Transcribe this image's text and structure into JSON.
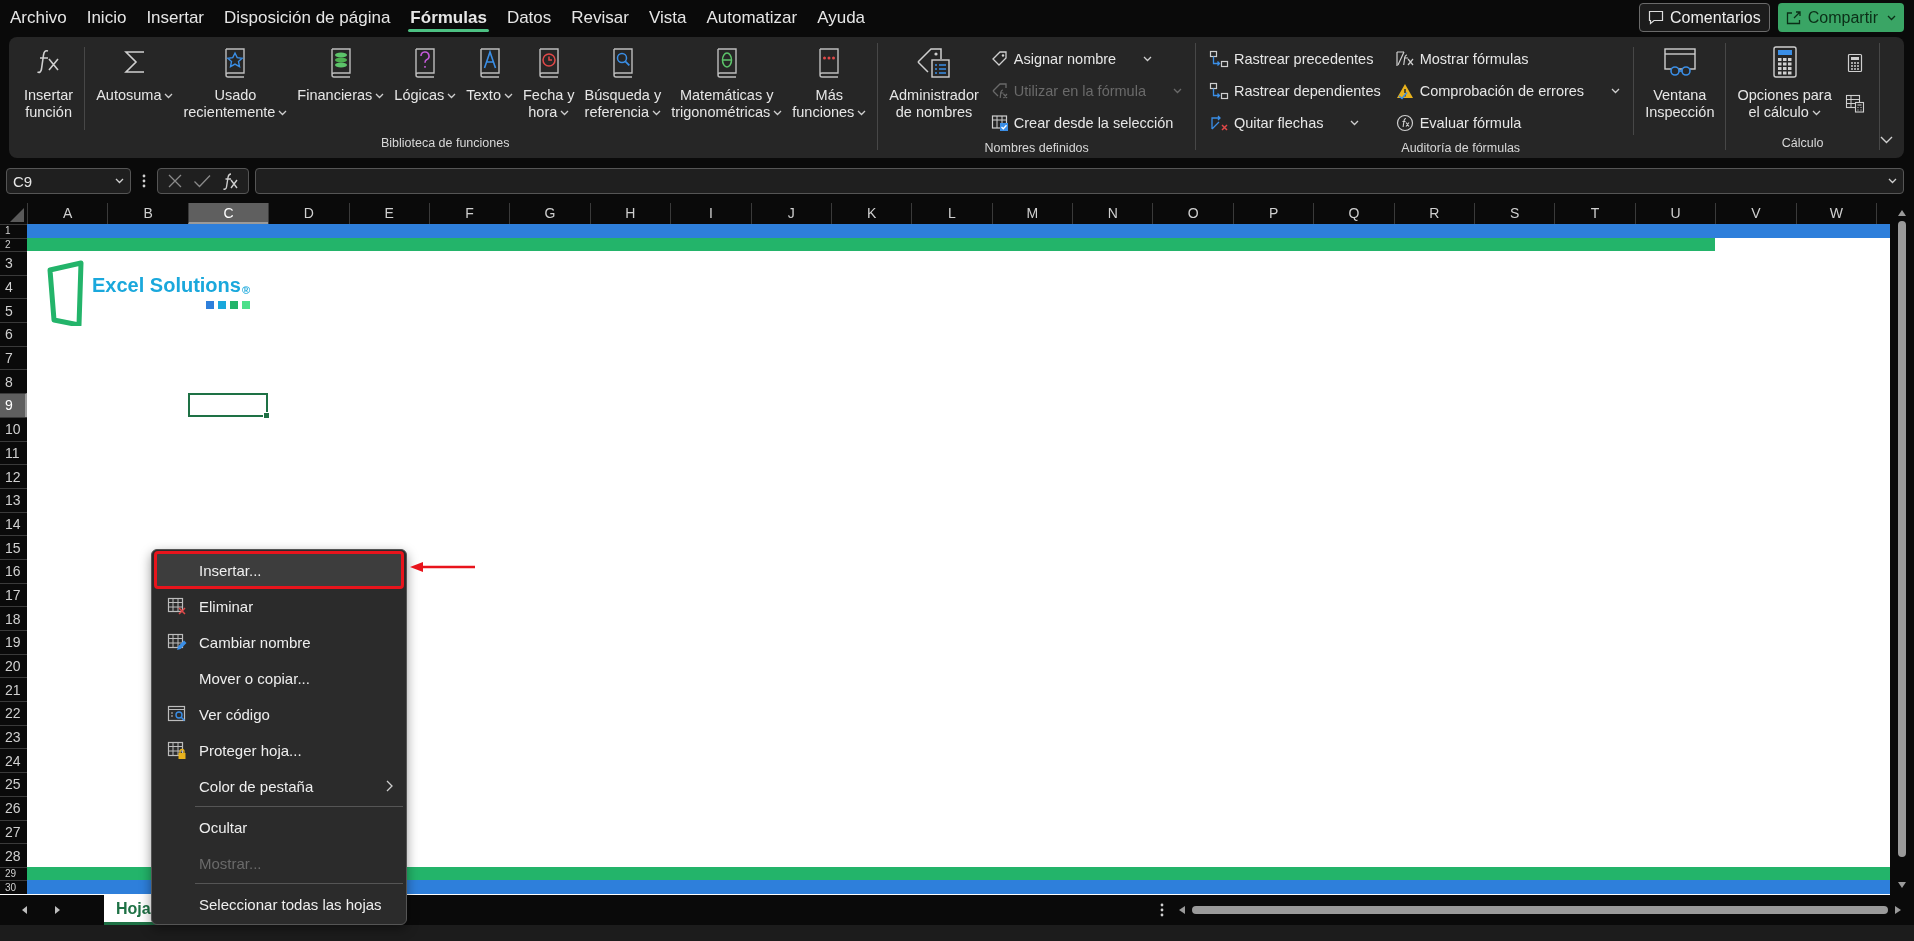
{
  "menu_tabs": [
    {
      "label": "Archivo",
      "selected": false
    },
    {
      "label": "Inicio",
      "selected": false
    },
    {
      "label": "Insertar",
      "selected": false
    },
    {
      "label": "Disposición de página",
      "selected": false
    },
    {
      "label": "Fórmulas",
      "selected": true
    },
    {
      "label": "Datos",
      "selected": false
    },
    {
      "label": "Revisar",
      "selected": false
    },
    {
      "label": "Vista",
      "selected": false
    },
    {
      "label": "Automatizar",
      "selected": false
    },
    {
      "label": "Ayuda",
      "selected": false
    }
  ],
  "header_buttons": [
    {
      "label": "Comentarios",
      "kind": "outline",
      "dropdown": false
    },
    {
      "label": "Compartir",
      "kind": "primary",
      "dropdown": true
    }
  ],
  "ribbon": {
    "groups": [
      {
        "label": "Biblioteca de funciones",
        "items": [
          {
            "kind": "large",
            "label": "Insertar\nfunción",
            "dropdown": false,
            "divider_after": true
          },
          {
            "kind": "large",
            "label": "Autosuma",
            "dropdown": true
          },
          {
            "kind": "large",
            "label": "Usado\nrecientemente",
            "dropdown": true
          },
          {
            "kind": "large",
            "label": "Financieras",
            "dropdown": true
          },
          {
            "kind": "large",
            "label": "Lógicas",
            "dropdown": true
          },
          {
            "kind": "large",
            "label": "Texto",
            "dropdown": true
          },
          {
            "kind": "large",
            "label": "Fecha y\nhora",
            "dropdown": true
          },
          {
            "kind": "large",
            "label": "Búsqueda y\nreferencia",
            "dropdown": true
          },
          {
            "kind": "large",
            "label": "Matemáticas y\ntrigonométricas",
            "dropdown": true
          },
          {
            "kind": "large",
            "label": "Más\nfunciones",
            "dropdown": true
          }
        ]
      },
      {
        "label": "Nombres definidos",
        "items": [
          {
            "kind": "large",
            "label": "Administrador\nde nombres",
            "dropdown": false
          },
          {
            "kind": "stack",
            "buttons": [
              {
                "label": "Asignar nombre",
                "dropdown": true,
                "disabled": false
              },
              {
                "label": "Utilizar en la fórmula",
                "dropdown": true,
                "disabled": true
              },
              {
                "label": "Crear desde la selección",
                "dropdown": false,
                "disabled": false
              }
            ]
          }
        ]
      },
      {
        "label": "Auditoría de fórmulas",
        "items": [
          {
            "kind": "stack",
            "buttons": [
              {
                "label": "Rastrear precedentes",
                "dropdown": false,
                "disabled": false
              },
              {
                "label": "Rastrear dependientes",
                "dropdown": false,
                "disabled": false
              },
              {
                "label": "Quitar flechas",
                "dropdown": true,
                "disabled": false
              }
            ]
          },
          {
            "kind": "stack",
            "buttons": [
              {
                "label": "Mostrar fórmulas",
                "dropdown": false,
                "disabled": false
              },
              {
                "label": "Comprobación de errores",
                "dropdown": true,
                "disabled": false
              },
              {
                "label": "Evaluar fórmula",
                "dropdown": false,
                "disabled": false
              }
            ]
          },
          {
            "kind": "large",
            "label": "Ventana\nInspección",
            "dropdown": false,
            "divider_before": true
          }
        ]
      },
      {
        "label": "Cálculo",
        "items": [
          {
            "kind": "large",
            "label": "Opciones para\nel cálculo",
            "dropdown": true
          },
          {
            "kind": "icon_stack"
          }
        ]
      }
    ]
  },
  "formula_bar": {
    "name_box": "C9"
  },
  "columns": [
    {
      "label": "A",
      "selected": false
    },
    {
      "label": "B",
      "selected": false
    },
    {
      "label": "C",
      "selected": true
    },
    {
      "label": "D",
      "selected": false
    },
    {
      "label": "E",
      "selected": false
    },
    {
      "label": "F",
      "selected": false
    },
    {
      "label": "G",
      "selected": false
    },
    {
      "label": "H",
      "selected": false
    },
    {
      "label": "I",
      "selected": false
    },
    {
      "label": "J",
      "selected": false
    },
    {
      "label": "K",
      "selected": false
    },
    {
      "label": "L",
      "selected": false
    },
    {
      "label": "M",
      "selected": false
    },
    {
      "label": "N",
      "selected": false
    },
    {
      "label": "O",
      "selected": false
    },
    {
      "label": "P",
      "selected": false
    },
    {
      "label": "Q",
      "selected": false
    },
    {
      "label": "R",
      "selected": false
    },
    {
      "label": "S",
      "selected": false
    },
    {
      "label": "T",
      "selected": false
    },
    {
      "label": "U",
      "selected": false
    },
    {
      "label": "V",
      "selected": false
    },
    {
      "label": "W",
      "selected": false
    }
  ],
  "rows": [
    {
      "label": "1",
      "selected": false,
      "color": "#2e7fdb",
      "band_partial": false
    },
    {
      "label": "2",
      "selected": false,
      "color": "#23b46a",
      "band_partial": true
    },
    {
      "label": "3",
      "selected": false
    },
    {
      "label": "4",
      "selected": false
    },
    {
      "label": "5",
      "selected": false
    },
    {
      "label": "6",
      "selected": false
    },
    {
      "label": "7",
      "selected": false
    },
    {
      "label": "8",
      "selected": false
    },
    {
      "label": "9",
      "selected": true
    },
    {
      "label": "10",
      "selected": false
    },
    {
      "label": "11",
      "selected": false
    },
    {
      "label": "12",
      "selected": false
    },
    {
      "label": "13",
      "selected": false
    },
    {
      "label": "14",
      "selected": false
    },
    {
      "label": "15",
      "selected": false
    },
    {
      "label": "16",
      "selected": false
    },
    {
      "label": "17",
      "selected": false
    },
    {
      "label": "18",
      "selected": false
    },
    {
      "label": "19",
      "selected": false
    },
    {
      "label": "20",
      "selected": false
    },
    {
      "label": "21",
      "selected": false
    },
    {
      "label": "22",
      "selected": false
    },
    {
      "label": "23",
      "selected": false
    },
    {
      "label": "24",
      "selected": false
    },
    {
      "label": "25",
      "selected": false
    },
    {
      "label": "26",
      "selected": false
    },
    {
      "label": "27",
      "selected": false
    },
    {
      "label": "28",
      "selected": false
    },
    {
      "label": "29",
      "selected": false,
      "color": "#23b46a",
      "band_partial": false
    },
    {
      "label": "30",
      "selected": false,
      "color": "#2e7fdb",
      "band_partial": false
    }
  ],
  "logo": {
    "text": "Excel Solutions",
    "mark": "®",
    "squares": [
      {
        "color": "#2e7fdb"
      },
      {
        "color": "#1aa8dc"
      },
      {
        "color": "#23b46a"
      },
      {
        "color": "#4be08a"
      }
    ]
  },
  "context_menu": {
    "items": [
      {
        "label": "Insertar...",
        "selected": true,
        "disabled": false,
        "submenu": false,
        "separator_before": false
      },
      {
        "label": "Eliminar",
        "selected": false,
        "disabled": false,
        "submenu": false,
        "separator_before": false
      },
      {
        "label": "Cambiar nombre",
        "selected": false,
        "disabled": false,
        "submenu": false,
        "separator_before": false
      },
      {
        "label": "Mover o copiar...",
        "selected": false,
        "disabled": false,
        "submenu": false,
        "separator_before": false
      },
      {
        "label": "Ver código",
        "selected": false,
        "disabled": false,
        "submenu": false,
        "separator_before": false
      },
      {
        "label": "Proteger hoja...",
        "selected": false,
        "disabled": false,
        "submenu": false,
        "separator_before": false
      },
      {
        "label": "Color de pestaña",
        "selected": false,
        "disabled": false,
        "submenu": true,
        "separator_before": false
      },
      {
        "label": "Ocultar",
        "selected": false,
        "disabled": false,
        "submenu": false,
        "separator_before": true
      },
      {
        "label": "Mostrar...",
        "selected": false,
        "disabled": true,
        "submenu": false,
        "separator_before": false
      },
      {
        "label": "Seleccionar todas las hojas",
        "selected": false,
        "disabled": false,
        "submenu": false,
        "separator_before": true
      }
    ]
  },
  "sheet_tabs": [
    {
      "label": "Hoja",
      "selected": true
    }
  ]
}
